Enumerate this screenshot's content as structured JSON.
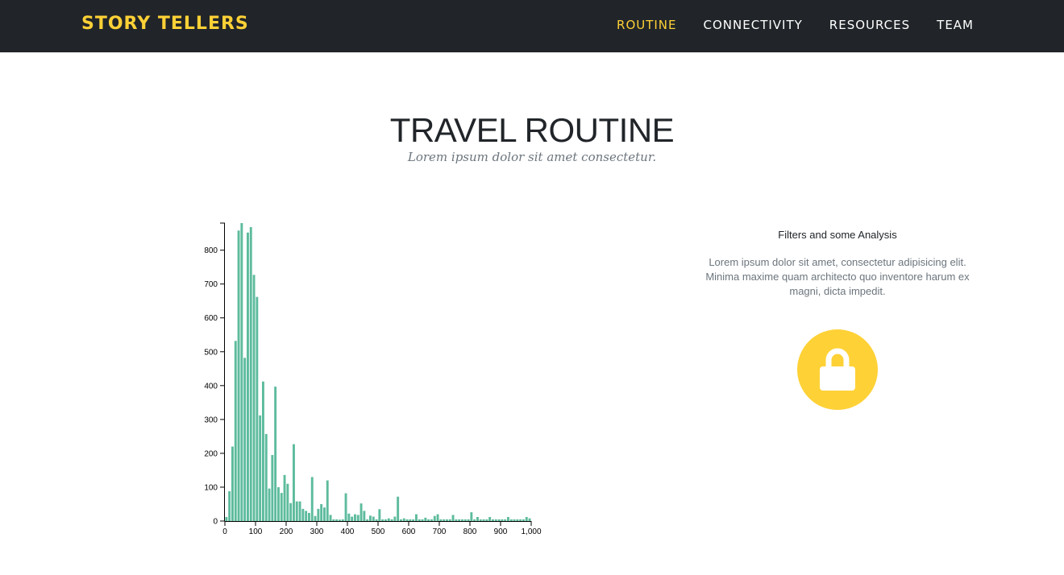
{
  "nav": {
    "brand": "STORY TELLERS",
    "items": [
      {
        "label": "ROUTINE",
        "active": true
      },
      {
        "label": "CONNECTIVITY",
        "active": false
      },
      {
        "label": "RESOURCES",
        "active": false
      },
      {
        "label": "TEAM",
        "active": false
      }
    ]
  },
  "heading": {
    "title": "TRAVEL ROUTINE",
    "subtitle": "Lorem ipsum dolor sit amet consectetur."
  },
  "side": {
    "title": "Filters and some Analysis",
    "text": "Lorem ipsum dolor sit amet, consectetur adipisicing elit. Minima maxime quam architecto quo inventore harum ex magni, dicta impedit.",
    "icon": "lock-icon"
  },
  "colors": {
    "accent": "#fed136",
    "navbar": "#212529",
    "bar": "#5dbb9d"
  },
  "chart_data": {
    "type": "bar",
    "title": "",
    "xlabel": "",
    "ylabel": "",
    "xlim": [
      0,
      1000
    ],
    "ylim": [
      0,
      880
    ],
    "xticks": [
      "0",
      "100",
      "200",
      "300",
      "400",
      "500",
      "600",
      "700",
      "800",
      "900",
      "1,000"
    ],
    "yticks": [
      "0",
      "100",
      "200",
      "300",
      "400",
      "500",
      "600",
      "700",
      "800"
    ],
    "grid": false,
    "x": [
      5,
      15,
      25,
      35,
      45,
      55,
      65,
      75,
      85,
      95,
      105,
      115,
      125,
      135,
      145,
      155,
      165,
      175,
      185,
      195,
      205,
      215,
      225,
      235,
      245,
      255,
      265,
      275,
      285,
      295,
      305,
      315,
      325,
      335,
      345,
      355,
      365,
      375,
      385,
      395,
      405,
      415,
      425,
      435,
      445,
      455,
      465,
      475,
      485,
      495,
      505,
      515,
      525,
      535,
      545,
      555,
      565,
      575,
      585,
      595,
      605,
      615,
      625,
      635,
      645,
      655,
      665,
      675,
      685,
      695,
      705,
      715,
      725,
      735,
      745,
      755,
      765,
      775,
      785,
      795,
      805,
      815,
      825,
      835,
      845,
      855,
      865,
      875,
      885,
      895,
      905,
      915,
      925,
      935,
      945,
      955,
      965,
      975,
      985,
      995
    ],
    "values": [
      12,
      88,
      220,
      532,
      858,
      880,
      482,
      852,
      868,
      727,
      662,
      312,
      412,
      257,
      96,
      195,
      397,
      100,
      83,
      136,
      110,
      53,
      227,
      58,
      58,
      36,
      30,
      24,
      130,
      15,
      36,
      50,
      40,
      120,
      18,
      5,
      5,
      4,
      5,
      82,
      22,
      13,
      20,
      18,
      52,
      30,
      5,
      16,
      13,
      5,
      35,
      5,
      5,
      8,
      5,
      13,
      72,
      5,
      8,
      5,
      5,
      5,
      20,
      5,
      5,
      10,
      5,
      5,
      15,
      20,
      5,
      5,
      5,
      5,
      18,
      5,
      5,
      5,
      5,
      5,
      26,
      5,
      12,
      5,
      5,
      5,
      12,
      5,
      5,
      5,
      5,
      5,
      12,
      5,
      5,
      5,
      5,
      5,
      12,
      8
    ]
  }
}
